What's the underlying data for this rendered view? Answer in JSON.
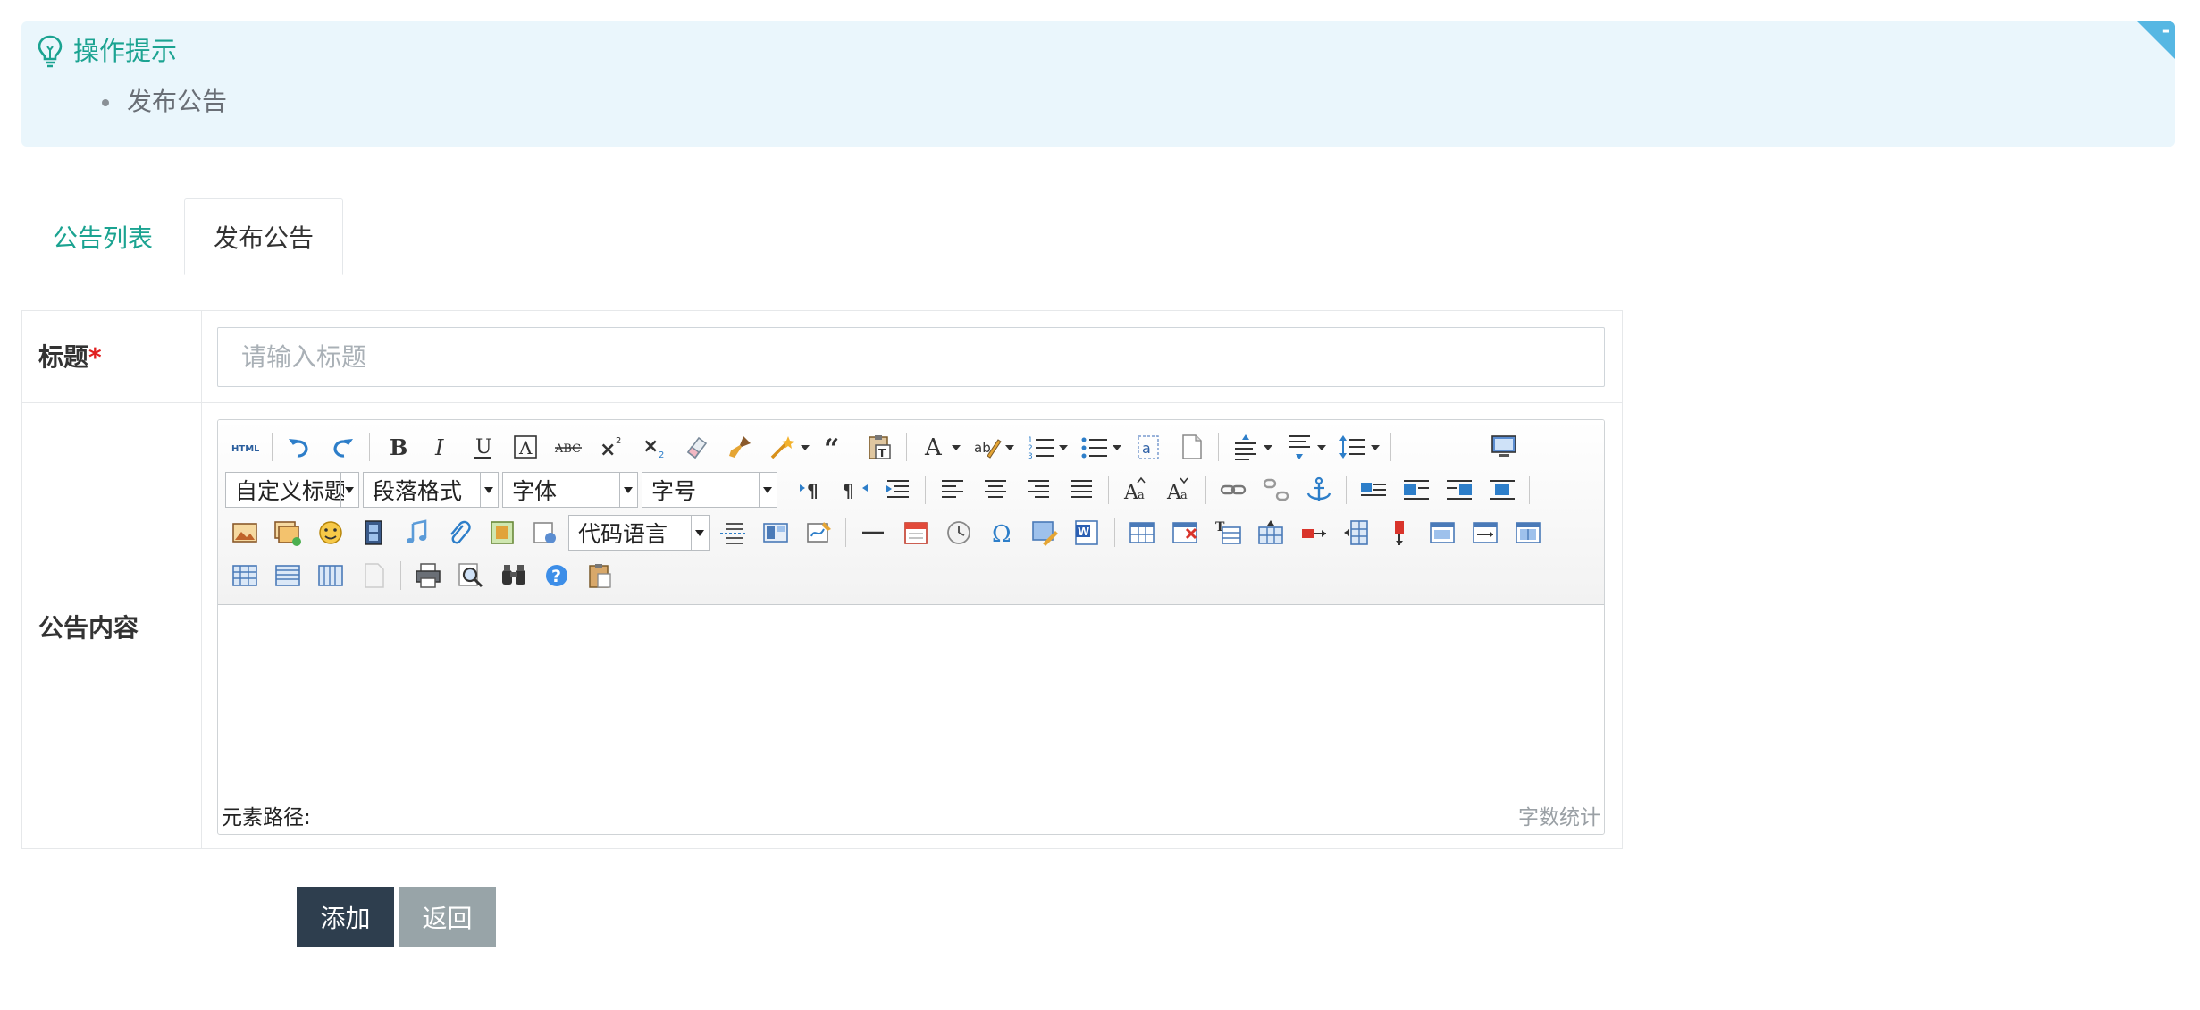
{
  "tips": {
    "title": "操作提示",
    "items": [
      "发布公告"
    ],
    "collapse_label": "-"
  },
  "tabs": [
    {
      "label": "公告列表",
      "active": false
    },
    {
      "label": "发布公告",
      "active": true
    }
  ],
  "form": {
    "title_label": "标题",
    "required_mark": "*",
    "title_placeholder": "请输入标题",
    "content_label": "公告内容"
  },
  "editor": {
    "combos": {
      "custom_title": "自定义标题",
      "paragraph": "段落格式",
      "font_family": "字体",
      "font_size": "字号",
      "code_lang": "代码语言"
    },
    "status_path": "元素路径:",
    "word_count": "字数统计"
  },
  "buttons": {
    "add": "添加",
    "back": "返回"
  },
  "colors": {
    "accent": "#1ba391",
    "tips_bg": "#eaf6fc",
    "primary_btn": "#2e3e4e",
    "secondary_btn": "#98a4a8",
    "corner": "#56b7e3"
  }
}
